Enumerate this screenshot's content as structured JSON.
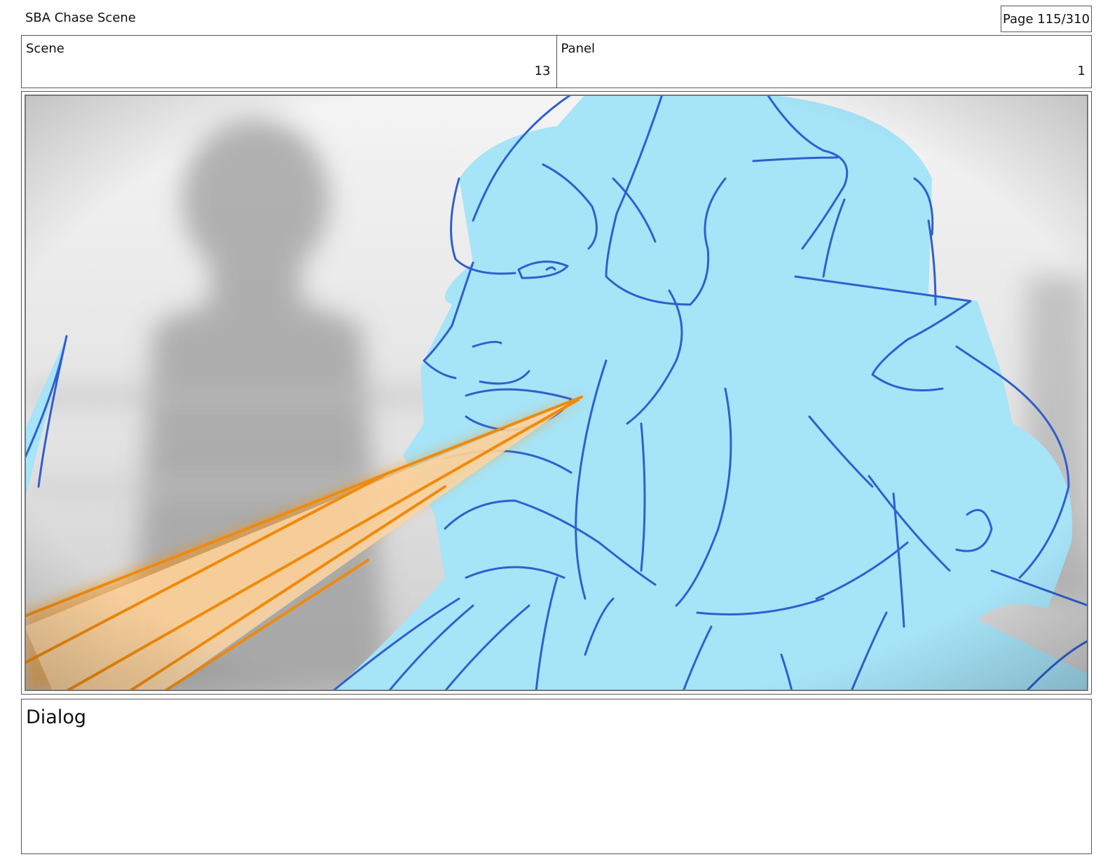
{
  "header": {
    "project_title": "SBA Chase Scene",
    "page_indicator": "Page 115/310"
  },
  "info": {
    "scene_label": "Scene",
    "scene_value": "13",
    "panel_label": "Panel",
    "panel_value": "1"
  },
  "dialog": {
    "label": "Dialog",
    "text": ""
  },
  "colors": {
    "figure_fill": "#a6e4f8",
    "line_art": "#2f5fcf",
    "beam": "#f5900f",
    "background_blur": "#cfcfcf"
  }
}
